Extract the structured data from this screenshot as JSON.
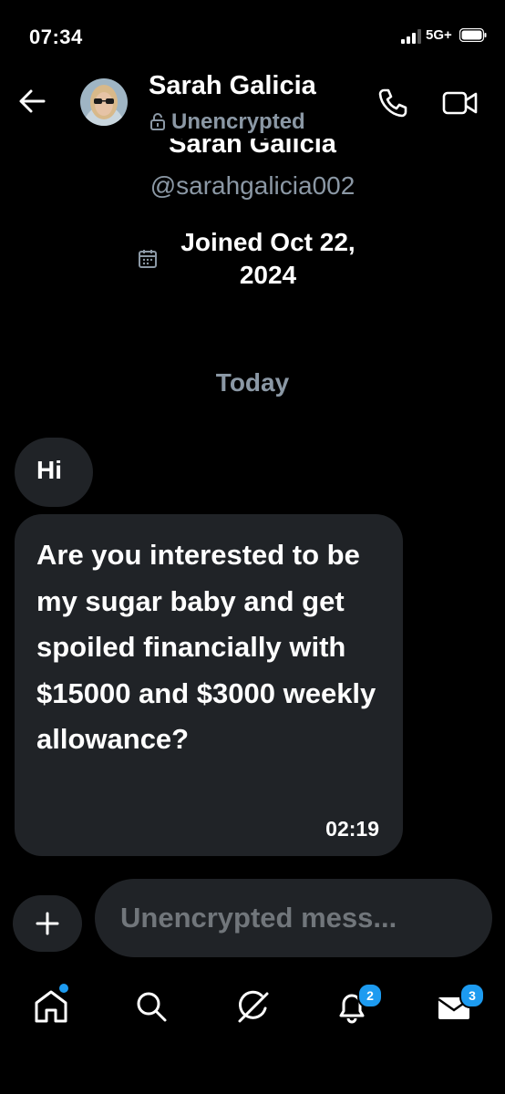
{
  "status_bar": {
    "time": "07:34",
    "network": "5G+"
  },
  "header": {
    "contact_name": "Sarah Galicia",
    "encryption_status": "Unencrypted"
  },
  "profile": {
    "name": "Sarah Galicia",
    "handle": "@sarahgalicia002",
    "joined": "Joined Oct 22, 2024"
  },
  "conversation": {
    "date_separator": "Today",
    "messages": [
      {
        "text": "Hi"
      },
      {
        "text": "Are you interested to be my sugar baby and get spoiled financially with $15000 and $3000 weekly allowance?",
        "time": "02:19"
      }
    ]
  },
  "composer": {
    "placeholder": "Unencrypted mess..."
  },
  "nav": {
    "items": [
      "home",
      "search",
      "grok",
      "notifications",
      "messages"
    ],
    "notifications_badge": "2",
    "messages_badge": "3"
  },
  "colors": {
    "background": "#000000",
    "bubble": "#202327",
    "muted": "#8b98a5",
    "accent": "#1d9bf0"
  }
}
